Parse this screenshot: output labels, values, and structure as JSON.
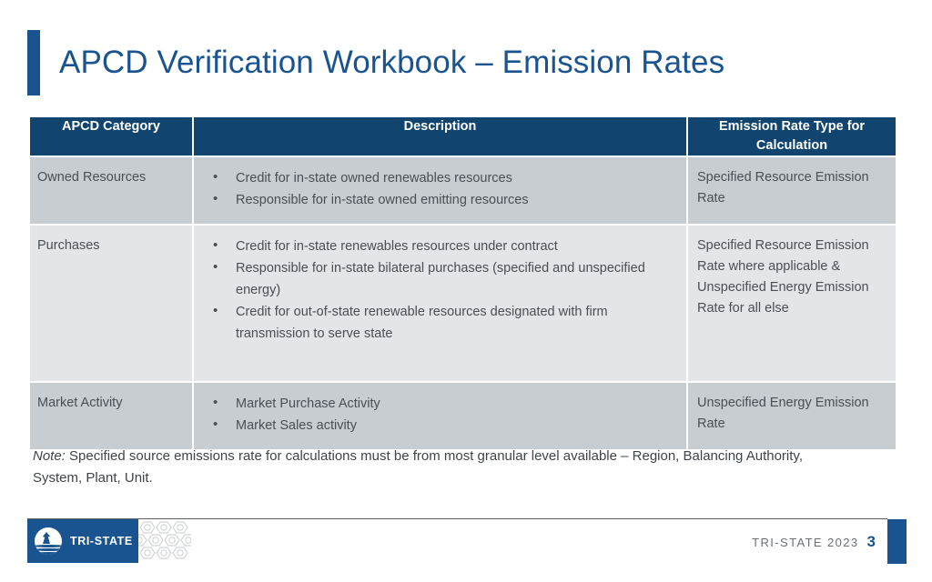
{
  "slide": {
    "title": "APCD Verification Workbook – Emission Rates",
    "accent_color": "#1a5490",
    "header_bg": "#11456f"
  },
  "table": {
    "headers": {
      "category": "APCD Category",
      "description": "Description",
      "rate": "Emission Rate Type for Calculation"
    },
    "rows": [
      {
        "category": "Owned Resources",
        "bullets": [
          "Credit for in-state owned renewables resources",
          "Responsible for in-state owned emitting resources"
        ],
        "rate": "Specified Resource Emission Rate"
      },
      {
        "category": "Purchases",
        "bullets": [
          "Credit for in-state renewables resources under contract",
          "Responsible for in-state bilateral purchases (specified and unspecified energy)",
          "Credit for out-of-state renewable resources designated with firm transmission to serve state"
        ],
        "rate": "Specified Resource Emission Rate where applicable & Unspecified Energy Emission Rate for all else"
      },
      {
        "category": "Market Activity",
        "bullets": [
          "Market Purchase Activity",
          "Market Sales activity"
        ],
        "rate": "Unspecified Energy Emission Rate"
      }
    ]
  },
  "note": {
    "label": "Note:",
    "text": " Specified source emissions rate for calculations must be from most granular level available – Region, Balancing Authority, System, Plant, Unit."
  },
  "footer": {
    "logo_text": "TRI-STATE",
    "meta": "TRI-STATE 2023",
    "page_number": "3"
  }
}
